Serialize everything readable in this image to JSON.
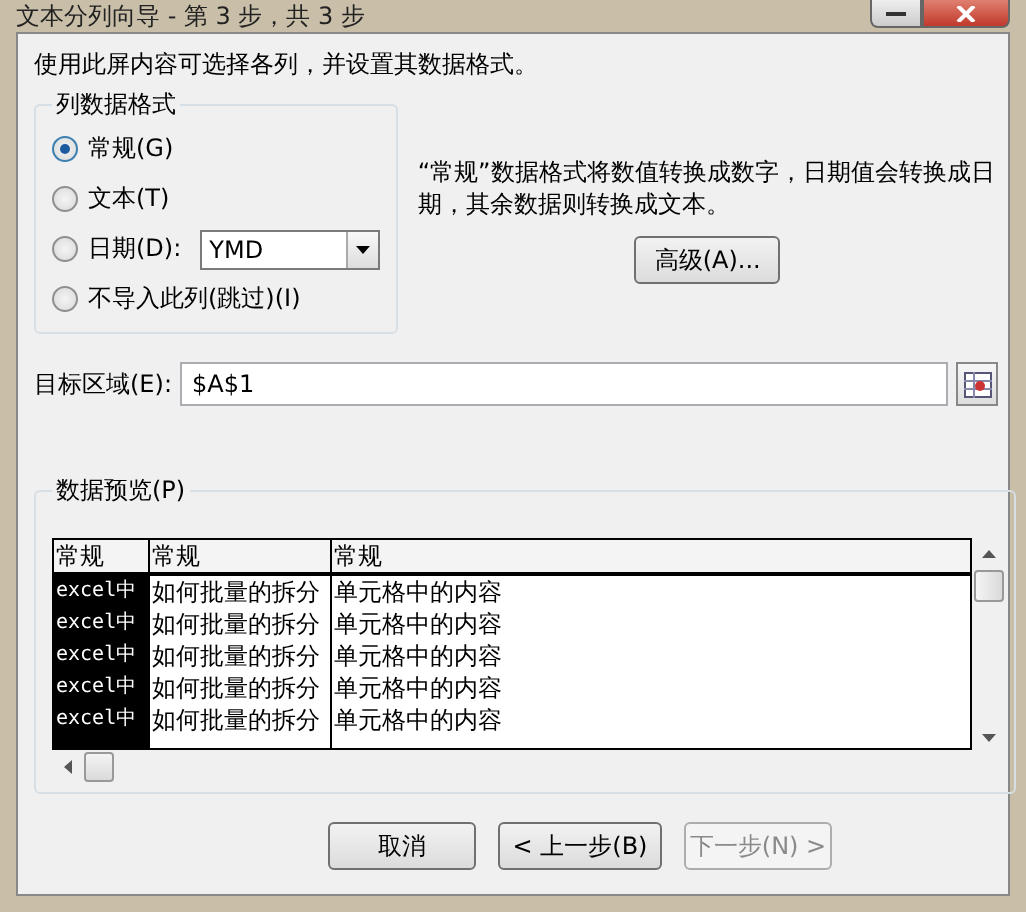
{
  "window": {
    "title": "文本分列向导 - 第 3 步，共 3 步"
  },
  "instruction": "使用此屏内容可选择各列，并设置其数据格式。",
  "column_format": {
    "label": "列数据格式",
    "options": [
      {
        "label": "常规(G)",
        "selected": true
      },
      {
        "label": "文本(T)",
        "selected": false
      },
      {
        "label": "日期(D):",
        "selected": false
      },
      {
        "label": "不导入此列(跳过)(I)",
        "selected": false
      }
    ],
    "date_format": {
      "value": "YMD"
    }
  },
  "description": "“常规”数据格式将数值转换成数字，日期值会转换成日期，其余数据则转换成文本。",
  "advanced_button": "高级(A)...",
  "destination": {
    "label": "目标区域(E):",
    "value": "$A$1"
  },
  "preview": {
    "label": "数据预览(P)",
    "columns": [
      {
        "header": "常规",
        "selected": true
      },
      {
        "header": "常规",
        "selected": false
      },
      {
        "header": "常规",
        "selected": false
      }
    ],
    "rows": [
      [
        "excel中",
        "如何批量的拆分",
        "单元格中的内容"
      ],
      [
        "excel中",
        "如何批量的拆分",
        "单元格中的内容"
      ],
      [
        "excel中",
        "如何批量的拆分",
        "单元格中的内容"
      ],
      [
        "excel中",
        "如何批量的拆分",
        "单元格中的内容"
      ],
      [
        "excel中",
        "如何批量的拆分",
        "单元格中的内容"
      ]
    ]
  },
  "buttons": [
    {
      "label": "取消",
      "disabled": false
    },
    {
      "label": "< 上一步(B)",
      "disabled": false
    },
    {
      "label": "下一步(N) >",
      "disabled": true
    }
  ]
}
